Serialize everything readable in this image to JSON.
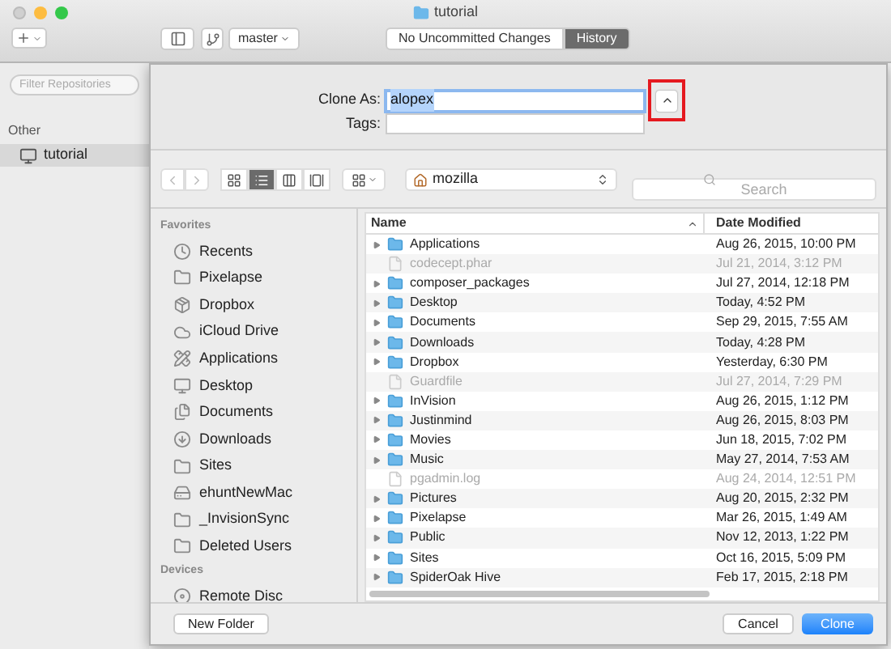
{
  "window": {
    "title": "tutorial"
  },
  "toolbar": {
    "branch": "master",
    "segments": [
      {
        "label": "No Uncommitted Changes",
        "selected": false
      },
      {
        "label": "History",
        "selected": true
      }
    ]
  },
  "sidebar": {
    "filter": {
      "placeholder": "Filter Repositories"
    },
    "section": "Other",
    "items": [
      {
        "label": "tutorial",
        "selected": true
      }
    ]
  },
  "sheet": {
    "clone_as": {
      "label": "Clone As:",
      "value": "alopex"
    },
    "tags": {
      "label": "Tags:"
    },
    "view_modes": [
      {
        "selected": false
      },
      {
        "selected": true
      },
      {
        "selected": false
      },
      {
        "selected": false
      }
    ],
    "location": "mozilla",
    "search": {
      "placeholder": "Search"
    },
    "favorites": {
      "title": "Favorites",
      "items": [
        {
          "label": "Recents",
          "kind": "recents"
        },
        {
          "label": "Pixelapse",
          "kind": "folder"
        },
        {
          "label": "Dropbox",
          "kind": "dropbox"
        },
        {
          "label": "iCloud Drive",
          "kind": "cloud"
        },
        {
          "label": "Applications",
          "kind": "apps"
        },
        {
          "label": "Desktop",
          "kind": "desktop"
        },
        {
          "label": "Documents",
          "kind": "documents"
        },
        {
          "label": "Downloads",
          "kind": "downloads"
        },
        {
          "label": "Sites",
          "kind": "folder"
        },
        {
          "label": "ehuntNewMac",
          "kind": "drive"
        },
        {
          "label": "_InvisionSync",
          "kind": "folder"
        },
        {
          "label": "Deleted Users",
          "kind": "folder"
        }
      ]
    },
    "devices": {
      "title": "Devices",
      "items": [
        {
          "label": "Remote Disc",
          "kind": "disc"
        }
      ]
    },
    "columns": [
      "Name",
      "Date Modified"
    ],
    "rows": [
      {
        "name": "Applications",
        "date": "Aug 26, 2015, 10:00 PM",
        "kind": "folder"
      },
      {
        "name": "codecept.phar",
        "date": "Jul 21, 2014, 3:12 PM",
        "kind": "file"
      },
      {
        "name": "composer_packages",
        "date": "Jul 27, 2014, 12:18 PM",
        "kind": "folder"
      },
      {
        "name": "Desktop",
        "date": "Today, 4:52 PM",
        "kind": "folder"
      },
      {
        "name": "Documents",
        "date": "Sep 29, 2015, 7:55 AM",
        "kind": "folder"
      },
      {
        "name": "Downloads",
        "date": "Today, 4:28 PM",
        "kind": "folder"
      },
      {
        "name": "Dropbox",
        "date": "Yesterday, 6:30 PM",
        "kind": "folder"
      },
      {
        "name": "Guardfile",
        "date": "Jul 27, 2014, 7:29 PM",
        "kind": "file"
      },
      {
        "name": "InVision",
        "date": "Aug 26, 2015, 1:12 PM",
        "kind": "folder"
      },
      {
        "name": "Justinmind",
        "date": "Aug 26, 2015, 8:03 PM",
        "kind": "folder"
      },
      {
        "name": "Movies",
        "date": "Jun 18, 2015, 7:02 PM",
        "kind": "folder"
      },
      {
        "name": "Music",
        "date": "May 27, 2014, 7:53 AM",
        "kind": "folder"
      },
      {
        "name": "pgadmin.log",
        "date": "Aug 24, 2014, 12:51 PM",
        "kind": "file"
      },
      {
        "name": "Pictures",
        "date": "Aug 20, 2015, 2:32 PM",
        "kind": "folder"
      },
      {
        "name": "Pixelapse",
        "date": "Mar 26, 2015, 1:49 AM",
        "kind": "folder"
      },
      {
        "name": "Public",
        "date": "Nov 12, 2013, 1:22 PM",
        "kind": "folder"
      },
      {
        "name": "Sites",
        "date": "Oct 16, 2015, 5:09 PM",
        "kind": "folder"
      },
      {
        "name": "SpiderOak Hive",
        "date": "Feb 17, 2015, 2:18 PM",
        "kind": "folder"
      }
    ],
    "buttons": {
      "new_folder": "New Folder",
      "cancel": "Cancel",
      "clone": "Clone"
    }
  }
}
